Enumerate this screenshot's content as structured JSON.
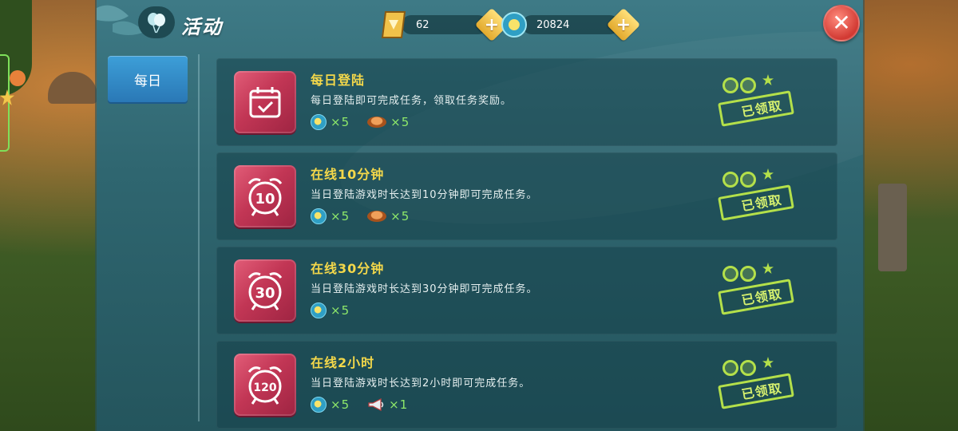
{
  "header": {
    "title": "活动",
    "title_icon": "balloon-icon",
    "currencies": [
      {
        "icon": "gem-card-icon",
        "value": "62"
      },
      {
        "icon": "sun-coin-icon",
        "value": "20824"
      }
    ],
    "close_icon": "close-icon"
  },
  "sidebar": {
    "tabs": [
      {
        "label": "每日",
        "selected": true
      }
    ]
  },
  "tasks": [
    {
      "icon": "calendar-check-icon",
      "title": "每日登陆",
      "description": "每日登陆即可完成任务，领取任务奖励。",
      "rewards": [
        {
          "icon": "sun-coin-icon",
          "qty": "×5"
        },
        {
          "icon": "meat-icon",
          "qty": "×5"
        }
      ],
      "status": "已领取"
    },
    {
      "icon": "alarm-clock-icon",
      "icon_label": "10",
      "title": "在线10分钟",
      "description": "当日登陆游戏时长达到10分钟即可完成任务。",
      "rewards": [
        {
          "icon": "sun-coin-icon",
          "qty": "×5"
        },
        {
          "icon": "meat-icon",
          "qty": "×5"
        }
      ],
      "status": "已领取"
    },
    {
      "icon": "alarm-clock-icon",
      "icon_label": "30",
      "title": "在线30分钟",
      "description": "当日登陆游戏时长达到30分钟即可完成任务。",
      "rewards": [
        {
          "icon": "sun-coin-icon",
          "qty": "×5"
        }
      ],
      "status": "已领取"
    },
    {
      "icon": "alarm-clock-icon",
      "icon_label": "120",
      "title": "在线2小时",
      "description": "当日登陆游戏时长达到2小时即可完成任务。",
      "rewards": [
        {
          "icon": "sun-coin-icon",
          "qty": "×5"
        },
        {
          "icon": "horn-icon",
          "qty": "×1"
        }
      ],
      "status": "已领取"
    }
  ],
  "colors": {
    "task_title": "#f4d84a",
    "reward_qty": "#8ee86a",
    "stamp": "#b4e04a",
    "tab_active": "#3d9fd8",
    "task_icon_bg": "#c23655"
  }
}
